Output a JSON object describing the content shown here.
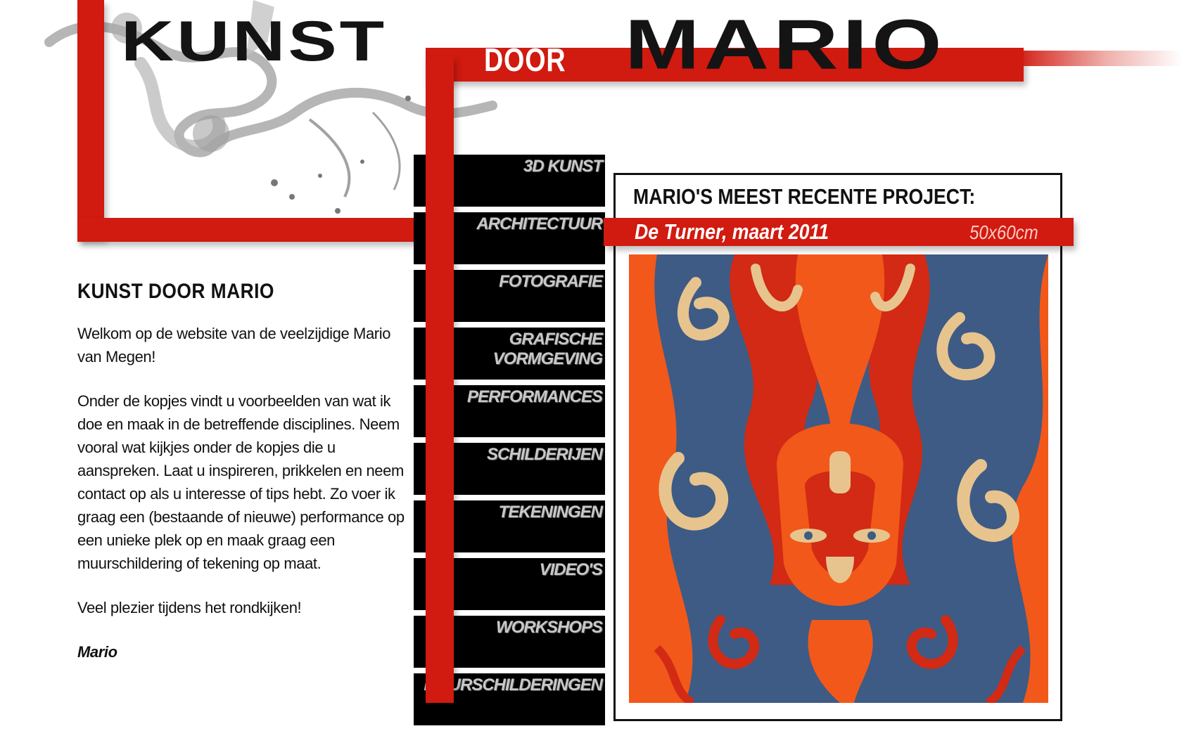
{
  "colors": {
    "accent_red": "#d11a10",
    "nav_background": "#000000",
    "nav_text": "#c8c8c8",
    "art_blue": "#3d5b85",
    "art_orange": "#f2581a",
    "art_red": "#d22a14",
    "art_cream": "#e7c48e"
  },
  "logo": {
    "word1": "KUNST",
    "word2": "DOOR",
    "word3": "MARIO"
  },
  "intro": {
    "heading": "KUNST DOOR MARIO",
    "paragraph1": "Welkom op de website van de veelzijdige Mario van Megen!",
    "paragraph2": "Onder de kopjes vindt u voorbeelden van wat ik doe en maak in de betreffende disciplines. Neem vooral wat kijkjes onder de kopjes die u aanspreken. Laat u inspireren, prikkelen en neem contact op als u interesse of tips hebt. Zo voer ik graag een (bestaande of nieuwe) performance op een unieke plek op en maak graag een muurschildering of tekening op maat.",
    "paragraph3": "Veel plezier tijdens het rondkijken!",
    "signature": "Mario"
  },
  "nav": {
    "items": [
      {
        "label": "3D KUNST"
      },
      {
        "label": "ARCHITECTUUR"
      },
      {
        "label": "FOTOGRAFIE"
      },
      {
        "label": "GRAFISCHE\nVORMGEVING"
      },
      {
        "label": "PERFORMANCES"
      },
      {
        "label": "SCHILDERIJEN"
      },
      {
        "label": "TEKENINGEN"
      },
      {
        "label": "VIDEO'S"
      },
      {
        "label": "WORKSHOPS"
      },
      {
        "label": "MUURSCHILDERINGEN"
      }
    ]
  },
  "project": {
    "heading": "MARIO'S MEEST RECENTE PROJECT:",
    "title": "De Turner, maart 2011",
    "size": "50x60cm"
  }
}
